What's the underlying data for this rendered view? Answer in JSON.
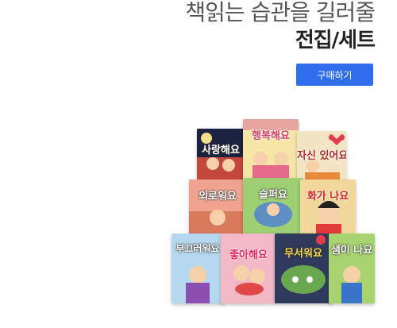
{
  "header": {
    "headline": "책읽는 습관을 길러줄",
    "subtitle": "전집/세트",
    "buy_label": "구매하기"
  },
  "books": [
    {
      "title": "사랑해요",
      "color": "#c3473b"
    },
    {
      "title": "행복해요",
      "color": "#f5e6a8"
    },
    {
      "title": "자신 있어요",
      "color": "#f3e5c4"
    },
    {
      "title": "외로워요",
      "color": "#f0a38e"
    },
    {
      "title": "슬퍼요",
      "color": "#9ecf72"
    },
    {
      "title": "화가 나요",
      "color": "#f1d79a"
    },
    {
      "title": "부끄러워요",
      "color": "#b5d8ee"
    },
    {
      "title": "좋아해요",
      "color": "#f2b8c6"
    },
    {
      "title": "무서워요",
      "color": "#2f3a5c"
    },
    {
      "title": "샘이 나요",
      "color": "#a8d46f"
    }
  ]
}
